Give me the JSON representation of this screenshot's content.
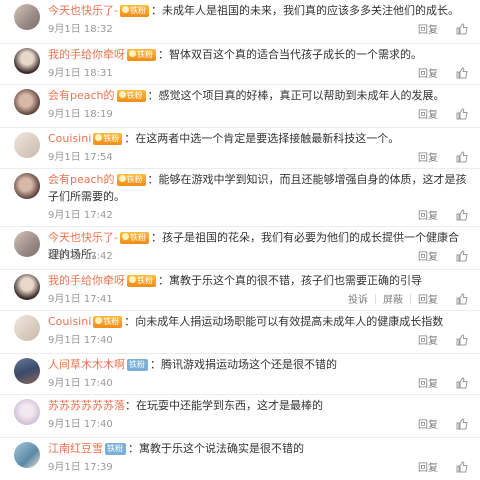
{
  "labels": {
    "reply": "回复",
    "report": "投诉",
    "block": "屏蔽",
    "gold_badge": "铁粉",
    "iron_badge": "铁粉"
  },
  "colors": {
    "username": "#eb7350",
    "meta": "#999999"
  },
  "comments": [
    {
      "username": "今天也快乐了-",
      "badge": "gold",
      "text": "：未成年人是祖国的未来，我们真的应该多多关注他们的成长。",
      "time": "9月1日 18:32"
    },
    {
      "username": "我的手给你牵呀",
      "badge": "gold",
      "text": "：智体双百这个真的适合当代孩子成长的一个需求的。",
      "time": "9月1日 18:31"
    },
    {
      "username": "会有peach的",
      "badge": "gold",
      "text": "：感觉这个项目真的好棒，真正可以帮助到未成年人的发展。",
      "time": "9月1日 18:19"
    },
    {
      "username": "Couisini",
      "badge": "gold",
      "text": "：在这两者中选一个肯定是要选择接触最新科技这一个。",
      "time": "9月1日 17:54"
    },
    {
      "username": "会有peach的",
      "badge": "gold",
      "text": "：能够在游戏中学到知识，而且还能够增强自身的体质，这才是孩子们所需要的。",
      "time": "9月1日 17:42"
    },
    {
      "username": "今天也快乐了-",
      "badge": "gold",
      "text": "：孩子是祖国的花朵，我们有必要为他们的成长提供一个健康合理的场所。",
      "time": "9月1日 17:42"
    },
    {
      "username": "我的手给你牵呀",
      "badge": "gold",
      "text": "：寓教于乐这个真的很不错，孩子们也需要正确的引导",
      "time": "9月1日 17:41"
    },
    {
      "username": "Couisini",
      "badge": "gold",
      "text": "：向未成年人捐运动场职能可以有效提高未成年人的健康成长指数",
      "time": "9月1日 17:40"
    },
    {
      "username": "人间草木木木啊",
      "badge": "iron",
      "text": "：腾讯游戏捐运动场这个还是很不错的",
      "time": "9月1日 17:40"
    },
    {
      "username": "苏苏苏苏苏苏落",
      "badge": "",
      "text": "：在玩耍中还能学到东西，这才是最棒的",
      "time": "9月1日 17:40"
    },
    {
      "username": "江南红豆雪",
      "badge": "iron",
      "text": "：寓教于乐这个说法确实是很不错的",
      "time": "9月1日 17:39"
    }
  ]
}
